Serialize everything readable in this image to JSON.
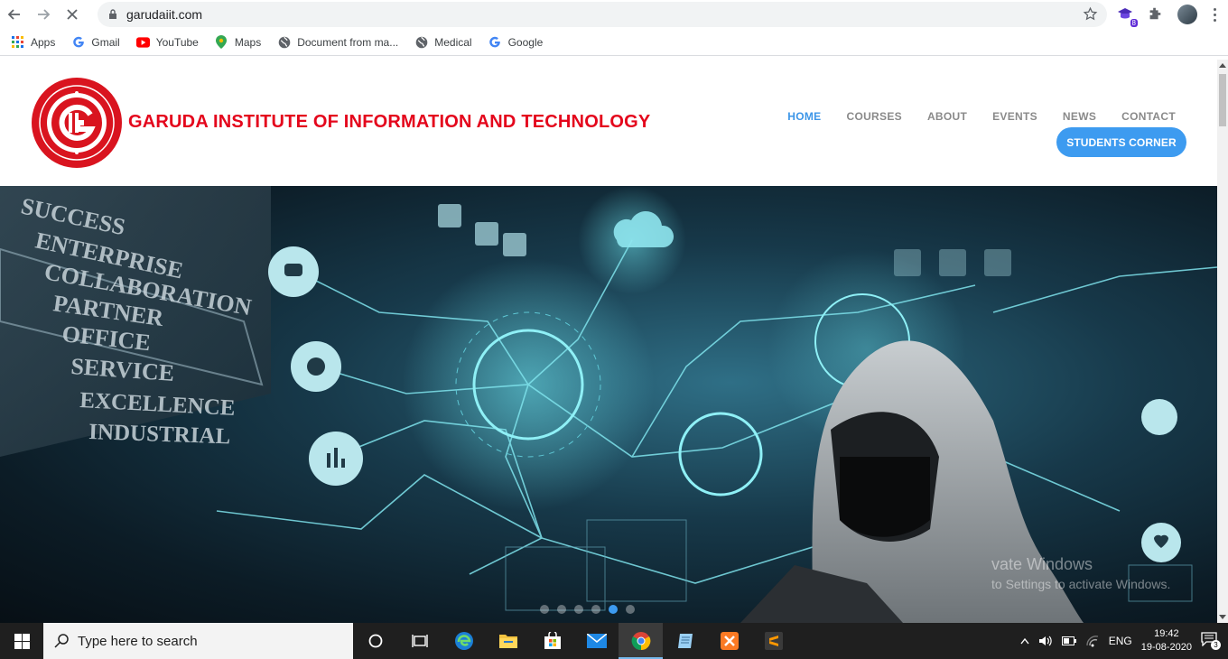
{
  "browser": {
    "url": "garudaiit.com",
    "extension_badge": "8"
  },
  "bookmarks": [
    {
      "label": "Apps",
      "icon": "apps-grid-icon"
    },
    {
      "label": "Gmail",
      "icon": "google-g-icon"
    },
    {
      "label": "YouTube",
      "icon": "youtube-icon"
    },
    {
      "label": "Maps",
      "icon": "maps-pin-icon"
    },
    {
      "label": "Document from ma...",
      "icon": "globe-icon"
    },
    {
      "label": "Medical",
      "icon": "globe-icon"
    },
    {
      "label": "Google",
      "icon": "google-g-icon"
    }
  ],
  "site": {
    "title": "GARUDA INSTITUTE OF INFORMATION AND TECHNOLOGY",
    "menu": [
      "HOME",
      "COURSES",
      "ABOUT",
      "EVENTS",
      "NEWS",
      "CONTACT"
    ],
    "active_menu": "HOME",
    "cta": "STUDENTS CORNER",
    "accent_color": "#3d9bf0",
    "title_color": "#e4061c"
  },
  "hero": {
    "board_words": [
      "SUCCESS",
      "ENTERPRISE",
      "COLLABORATION",
      "PARTNER",
      "OFFICE",
      "SERVICE",
      "EXCELLENCE",
      "INDUSTRIAL"
    ],
    "watermark_line1": "vate Windows",
    "watermark_line2": "to Settings to activate Windows.",
    "slide_count": 6,
    "active_slide": 5
  },
  "taskbar": {
    "search_placeholder": "Type here to search",
    "language": "ENG",
    "time": "19:42",
    "date": "19-08-2020",
    "notifications": "3"
  }
}
